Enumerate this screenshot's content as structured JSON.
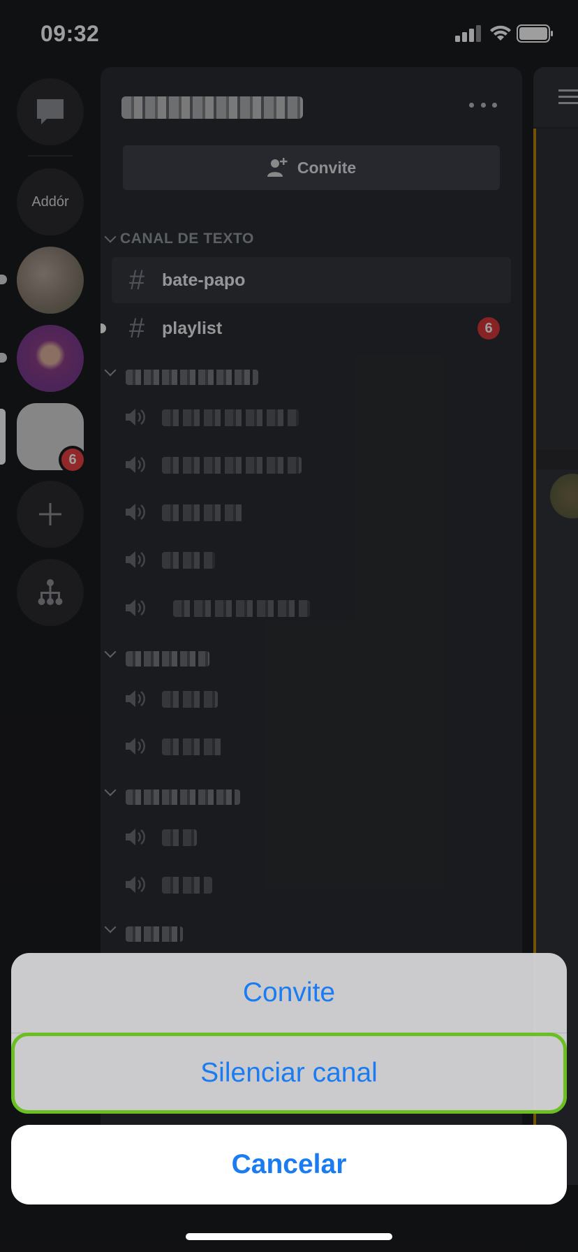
{
  "status_bar": {
    "time": "09:32"
  },
  "rail": {
    "add_label": "Addór",
    "server_badge": "6"
  },
  "server_header": {
    "invite_label": "Convite"
  },
  "categories": {
    "text": "CANAL DE TEXTO"
  },
  "text_channels": [
    {
      "label": "bate-papo",
      "badge": ""
    },
    {
      "label": "playlist",
      "badge": "6"
    }
  ],
  "action_sheet": {
    "items": [
      "Convite",
      "Silenciar canal"
    ],
    "cancel": "Cancelar"
  },
  "colors": {
    "accent": "#1a7cf0",
    "highlight": "#6bbf23",
    "badge": "#da373c"
  }
}
